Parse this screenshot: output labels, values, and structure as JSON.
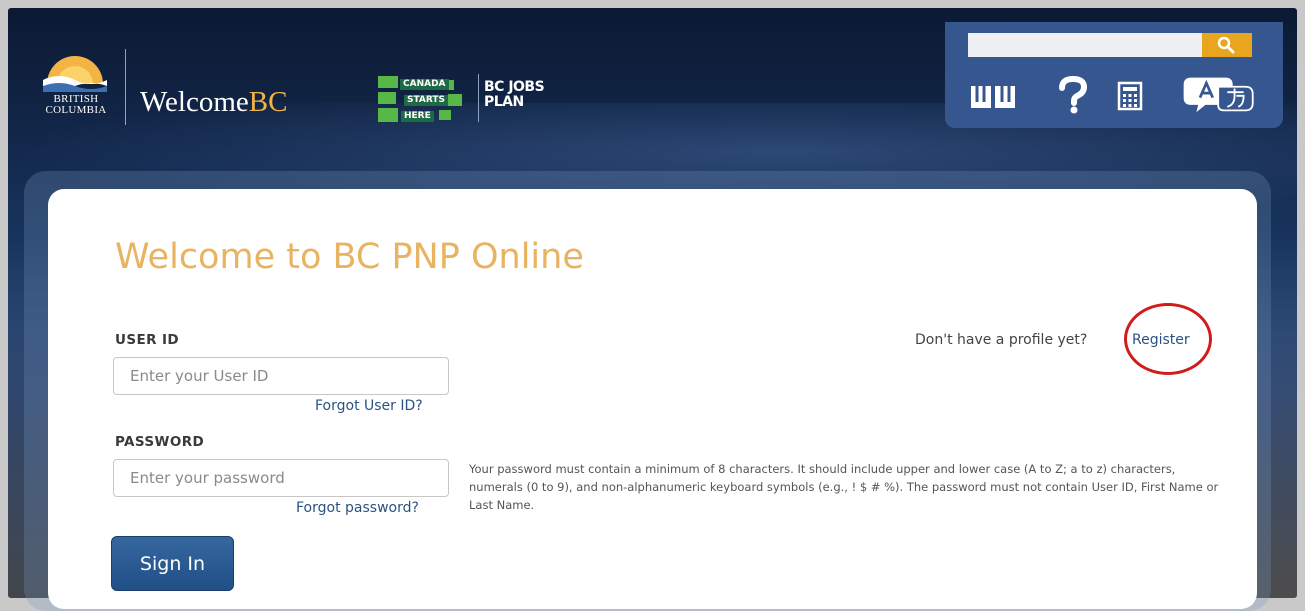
{
  "header": {
    "bc_logo_text": [
      "BRITISH",
      "COLUMBIA"
    ],
    "welcome_brand": {
      "prefix": "Welcome",
      "suffix": "BC"
    },
    "canada_badge": [
      "CANADA",
      "STARTS",
      "HERE"
    ],
    "jobs_plan": [
      "BC JOBS",
      "PLAN"
    ],
    "search": {
      "value": "",
      "placeholder": ""
    },
    "tools": [
      "book-icon",
      "help-icon",
      "calculator-icon",
      "translate-icon"
    ]
  },
  "login": {
    "title": "Welcome to BC PNP Online",
    "register_prompt": "Don't have a profile yet?",
    "register_link": "Register",
    "user_id_label": "USER ID",
    "user_id_placeholder": "Enter your User ID",
    "forgot_user_id": "Forgot User ID?",
    "password_label": "PASSWORD",
    "password_placeholder": "Enter your password",
    "forgot_password": "Forgot password?",
    "password_help": "Your password must contain a minimum of 8 characters. It should include upper and lower case (A to Z; a to z) characters, numerals (0 to 9), and non-alphanumeric keyboard symbols (e.g., ! $ # %). The password must not contain User ID, First Name or Last Name.",
    "signin_label": "Sign In"
  },
  "colors": {
    "title_gold": "#e8b462",
    "button_blue": "#2a5b94",
    "highlight_red": "#d21b1b",
    "search_orange": "#e8a51e"
  }
}
